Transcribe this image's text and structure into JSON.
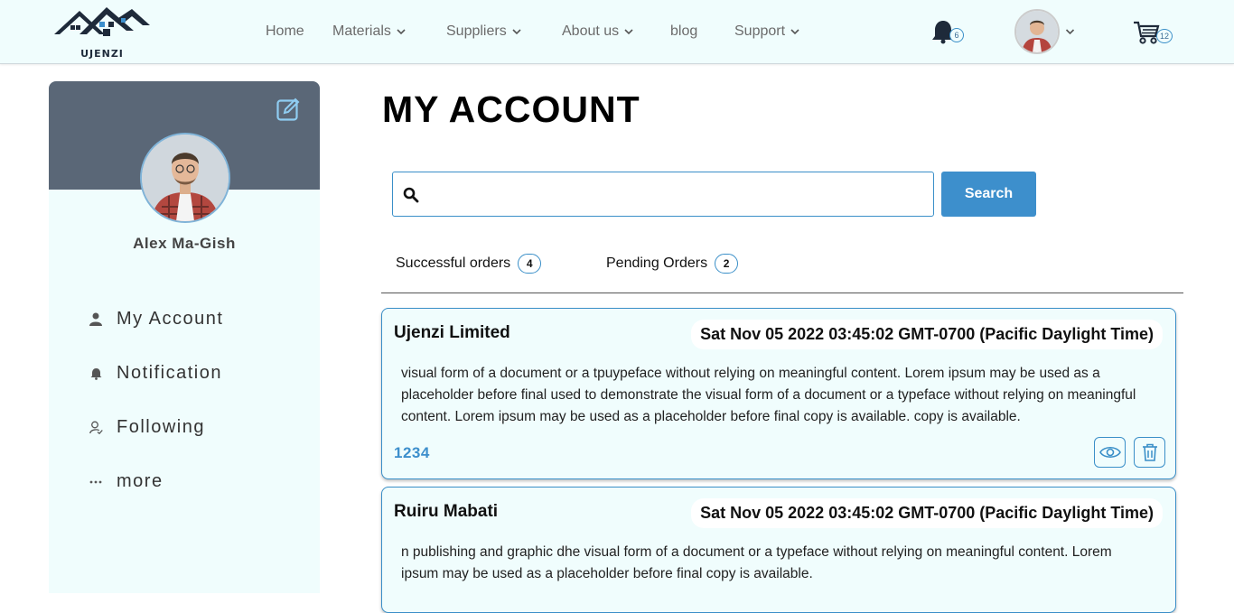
{
  "header": {
    "logo_text": "UJENZI",
    "nav": [
      {
        "label": "Home",
        "has_dropdown": false
      },
      {
        "label": "Materials",
        "has_dropdown": true
      },
      {
        "label": "Suppliers",
        "has_dropdown": true
      },
      {
        "label": "About us",
        "has_dropdown": true
      },
      {
        "label": "blog",
        "has_dropdown": false
      },
      {
        "label": "Support",
        "has_dropdown": true
      }
    ],
    "notification_count": "6",
    "cart_count": "12"
  },
  "sidebar": {
    "user_name": "Alex Ma-Gish",
    "items": [
      {
        "label": "My Account",
        "icon": "user-icon"
      },
      {
        "label": "Notification",
        "icon": "bell-icon"
      },
      {
        "label": "Following",
        "icon": "user-check-icon"
      },
      {
        "label": "more",
        "icon": "ellipsis-icon"
      }
    ]
  },
  "main": {
    "title": "MY ACCOUNT",
    "search": {
      "placeholder": "",
      "value": "",
      "button_label": "Search"
    },
    "tabs": [
      {
        "label": "Successful orders",
        "count": "4"
      },
      {
        "label": "Pending Orders",
        "count": "2"
      }
    ],
    "orders": [
      {
        "supplier": "Ujenzi Limited",
        "date": "Sat Nov 05 2022 03:45:02 GMT-0700 (Pacific Daylight Time)",
        "description": "visual form of a document or a tpuypeface without relying on meaningful content. Lorem ipsum may be used as a placeholder before final used to demonstrate the visual form of a document or a typeface without relying on meaningful content. Lorem ipsum may be used as a placeholder before final copy is available. copy is available.",
        "code": "1234"
      },
      {
        "supplier": "Ruiru Mabati",
        "date": "Sat Nov 05 2022 03:45:02 GMT-0700 (Pacific Daylight Time)",
        "description": "n publishing and graphic dhe visual form of a document or a typeface without relying on meaningful content. Lorem ipsum may be used as a placeholder before final copy is available.",
        "code": ""
      }
    ]
  },
  "colors": {
    "accent": "#3d8fcc",
    "header_bg": "#f0fdfd",
    "sidebar_head": "#5a6777",
    "navy": "#1e2a3a"
  }
}
